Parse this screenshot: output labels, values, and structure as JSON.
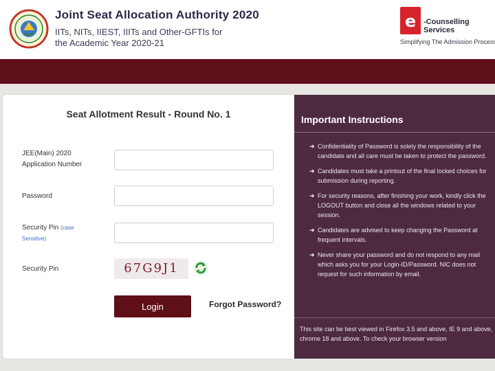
{
  "header": {
    "org_title": "Joint Seat Allocation Authority 2020",
    "org_subtitle": "IITs, NITs, IIEST, IIITs and Other-GFTIs for the Academic Year 2020-21",
    "brand_name": "-Counselling Services",
    "brand_tagline": "Simplifying The Admission Process",
    "band_color": "#5e0f18"
  },
  "form": {
    "title": "Seat Allotment Result - Round No. 1",
    "application_label": "JEE(Main) 2020 Application Number",
    "application_value": "",
    "password_label": "Password",
    "password_value": "",
    "security_pin_label": "Security Pin",
    "security_pin_link": "(case Sensitive)",
    "security_pin_value": "",
    "captcha_label": "Security Pin",
    "captcha_text": "67G9J1",
    "login_label": "Login",
    "forgot_label": "Forgot Password?"
  },
  "instructions": {
    "title": "Important Instructions",
    "items": [
      "Confidentiality of Password is solely the responsibility of the candidate and all care must be taken to protect the password.",
      "Candidates must take a printout of the final locked choices for submission during reporting.",
      "For security reasons, after finishing your work, kindly click the LOGOUT button and close all the windows related to your session.",
      "Candidates are advised to keep changing the Password at frequent intervals.",
      "Never share your password and do not respond to any mail which asks you for your Login-ID/Password. NIC does not request for such information by email."
    ],
    "footer": "This site can be best viewed in Firefox 3.5 and above, IE 9 and above, chrome 18 and above. To check your browser version"
  },
  "colors": {
    "accent": "#5e0f18",
    "panel": "#4d2a40"
  },
  "icons": {
    "logo_left": "josaa-emblem",
    "logo_right": "e-counselling-logo",
    "refresh": "refresh-icon",
    "bullet": "arrow-right-icon"
  }
}
